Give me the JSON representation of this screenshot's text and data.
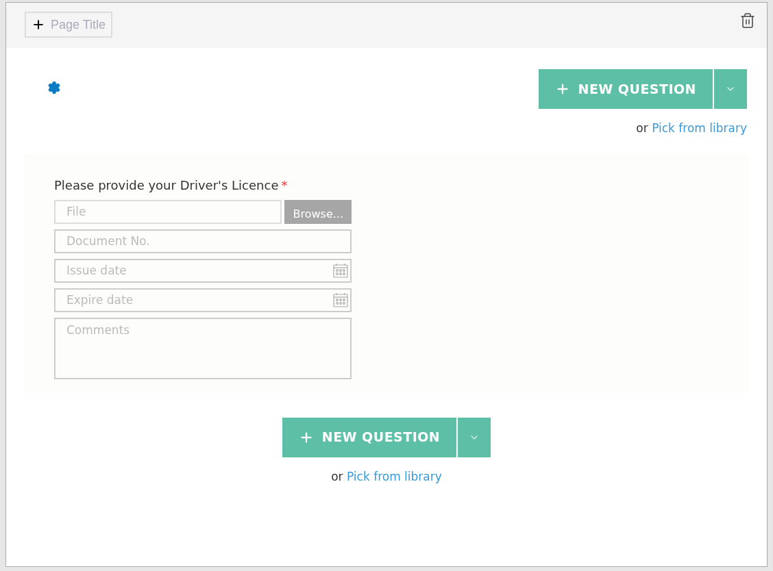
{
  "header": {
    "page_title_button": "Page Title"
  },
  "top_actions": {
    "new_question": "NEW QUESTION",
    "or_text": "or",
    "library_link": "Pick from library"
  },
  "question": {
    "label": "Please provide your Driver's Licence",
    "required_mark": "*",
    "fields": [
      {
        "kind": "file",
        "placeholder": "File",
        "button": "Browse..."
      },
      {
        "kind": "text",
        "placeholder": "Document No."
      },
      {
        "kind": "date",
        "placeholder": "Issue date"
      },
      {
        "kind": "date",
        "placeholder": "Expire date"
      },
      {
        "kind": "textarea",
        "placeholder": "Comments"
      }
    ]
  },
  "bottom_actions": {
    "new_question": "NEW QUESTION",
    "or_text": "or",
    "library_link": "Pick from library"
  }
}
